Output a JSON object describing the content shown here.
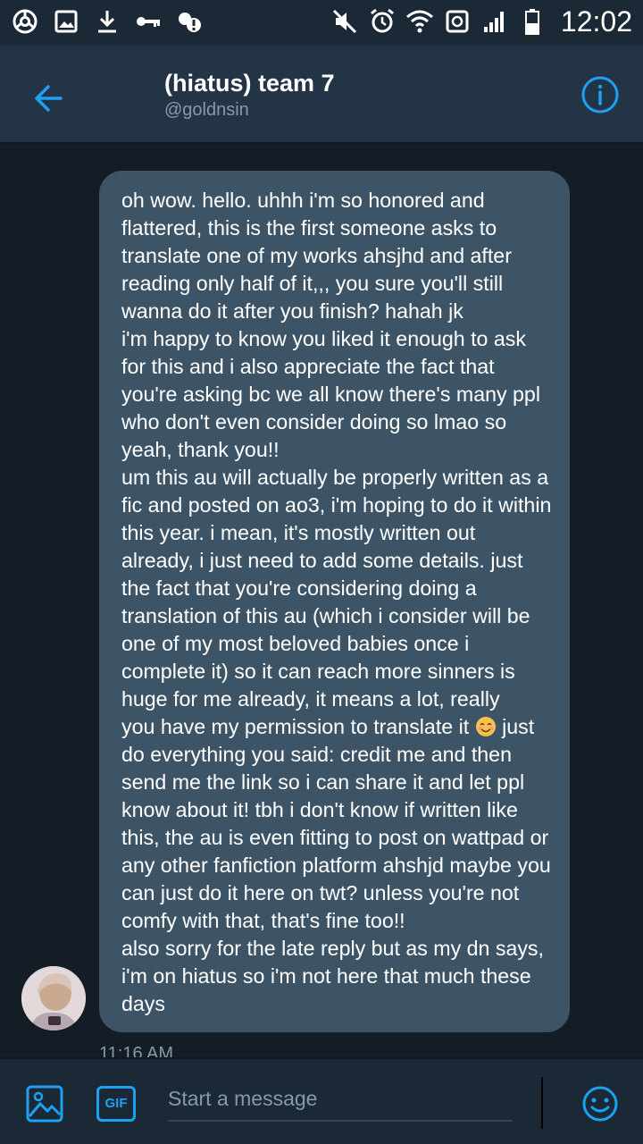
{
  "status_bar": {
    "time": "12:02",
    "left_icons": [
      "chrome-icon",
      "image-notification-icon",
      "download-icon",
      "key-icon",
      "vpn-alert-icon"
    ],
    "right_icons": [
      "mute-icon",
      "alarm-icon",
      "wifi-icon",
      "data-sync-icon",
      "signal-icon",
      "battery-icon"
    ]
  },
  "header": {
    "title": "(hiatus) team 7",
    "handle": "@goldnsin"
  },
  "message": {
    "text_part1": "oh wow. hello. uhhh i'm so honored and flattered, this is the first someone asks to translate one of my works ahsjhd and after reading only half of it,,, you sure you'll still wanna do it after you finish? hahah jk\ni'm happy to know you liked it enough to ask for this and i also appreciate the fact that you're asking bc we all know there's many ppl who don't even consider doing so lmao so yeah, thank you!!\num this au will actually be properly written as a fic and posted on ao3, i'm hoping to do it within this year. i mean, it's mostly written out already, i just need to add some details. just the fact that you're considering doing a translation of this au (which i consider will be one of my most beloved babies once i complete it) so it can reach more sinners is huge for me already, it means a lot, really\nyou have my permission to translate it",
    "emoji": "smiling-face-emoji",
    "text_part2": " just do everything you said: credit me and then send me the link so i can share it and let ppl know about it! tbh i don't know if written like this, the au is even fitting to post on wattpad or any other fanfiction platform ahshjd maybe you can just do it here on twt? unless you're not comfy with that, that's fine too!!\nalso sorry for the late reply but as my dn says, i'm on hiatus so i'm not here that much these days",
    "timestamp": "11:16 AM"
  },
  "compose": {
    "placeholder": "Start a message",
    "gif_label": "GIF"
  },
  "colors": {
    "accent": "#1da1f2",
    "background": "#141d26",
    "header_bg": "#243447",
    "bubble_bg": "#3d5466",
    "secondary_text": "#8899a6"
  }
}
